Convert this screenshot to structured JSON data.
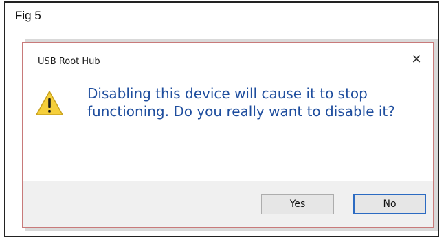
{
  "figure": {
    "label": "Fig 5"
  },
  "dialog": {
    "title": "USB Root Hub",
    "close_glyph": "✕",
    "icon": "warning-icon",
    "message": "Disabling this device will cause it to stop functioning. Do you really want to disable it?",
    "buttons": {
      "yes_label": "Yes",
      "no_label": "No"
    },
    "default_button": "No"
  },
  "colors": {
    "message_text": "#1f4e9e",
    "warning_fill": "#f5cf3b",
    "dialog_border": "#c87a7a",
    "default_button_border": "#2c6bc2"
  }
}
